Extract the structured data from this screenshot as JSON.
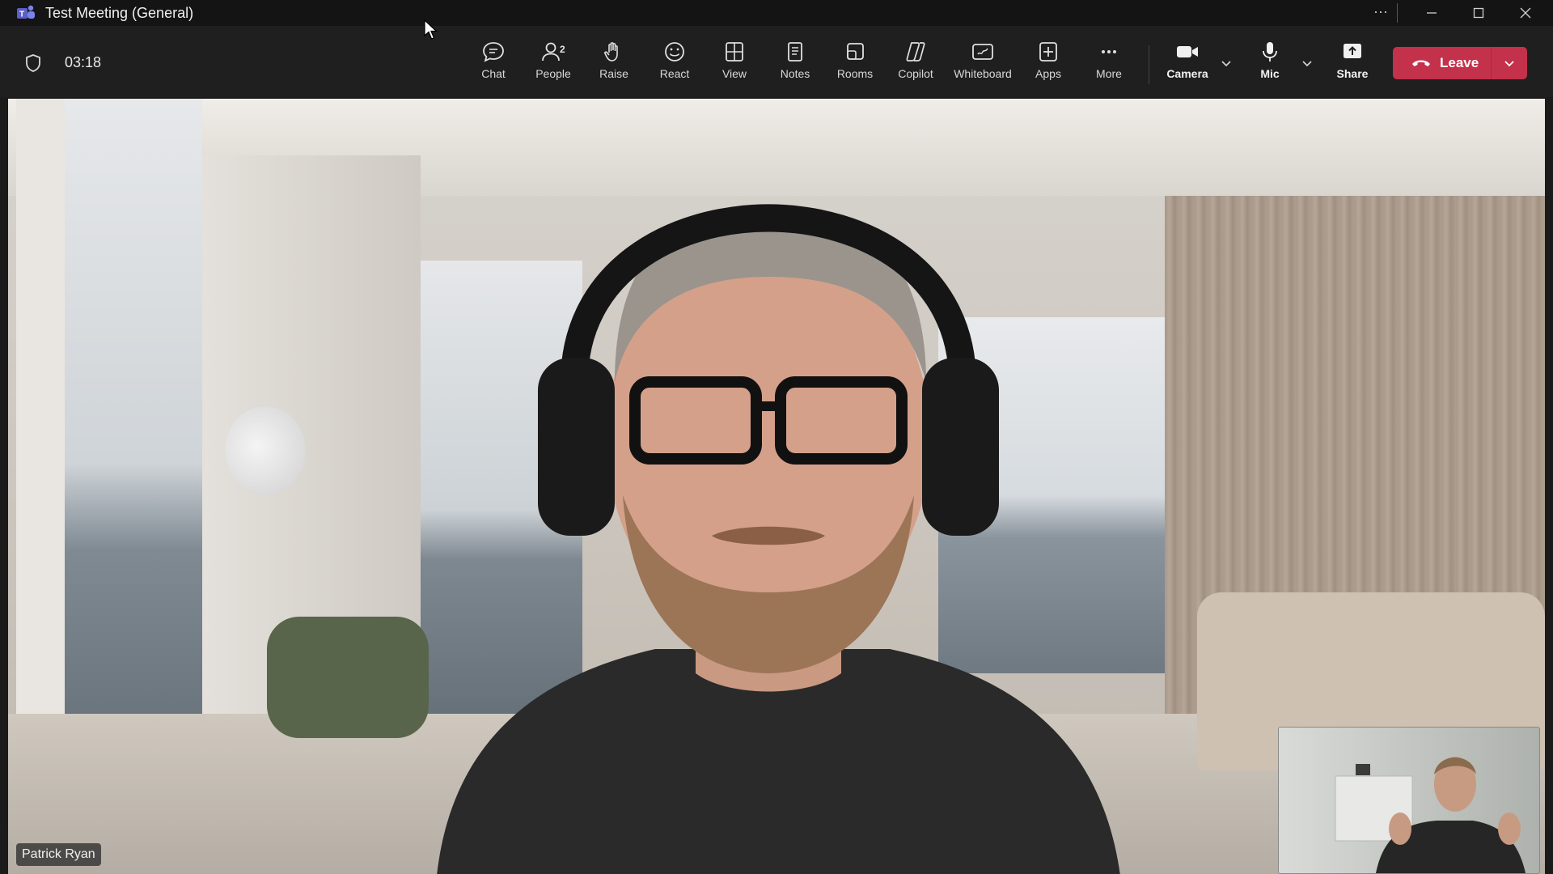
{
  "window": {
    "title": "Test Meeting (General)",
    "more_glyph": "···"
  },
  "meeting": {
    "timer": "03:18"
  },
  "toolbar": {
    "items": [
      {
        "label": "Chat",
        "icon": "chat-icon"
      },
      {
        "label": "People",
        "icon": "people-icon",
        "badge": "2"
      },
      {
        "label": "Raise",
        "icon": "hand-icon"
      },
      {
        "label": "React",
        "icon": "smile-icon"
      },
      {
        "label": "View",
        "icon": "view-grid-icon"
      },
      {
        "label": "Notes",
        "icon": "notes-icon"
      },
      {
        "label": "Rooms",
        "icon": "rooms-icon"
      },
      {
        "label": "Copilot",
        "icon": "copilot-icon"
      },
      {
        "label": "Whiteboard",
        "icon": "whiteboard-icon"
      },
      {
        "label": "Apps",
        "icon": "apps-icon"
      },
      {
        "label": "More",
        "icon": "more-icon"
      }
    ],
    "camera_label": "Camera",
    "mic_label": "Mic",
    "share_label": "Share",
    "leave_label": "Leave"
  },
  "participants": {
    "main_name": "Patrick Ryan"
  },
  "colors": {
    "leave_button": "#c4314b",
    "background": "#1f1f1f",
    "app_brand": "#5b5fc7"
  }
}
